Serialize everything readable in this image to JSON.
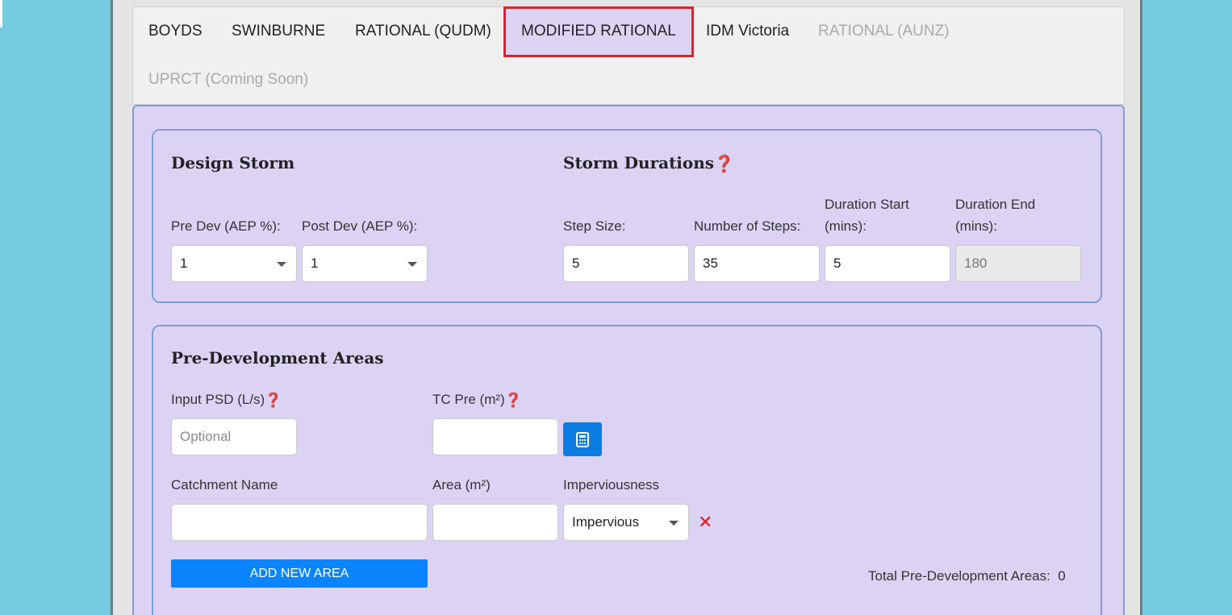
{
  "tabs": [
    {
      "label": "BOYDS",
      "state": "normal"
    },
    {
      "label": "SWINBURNE",
      "state": "normal"
    },
    {
      "label": "RATIONAL (QUDM)",
      "state": "normal"
    },
    {
      "label": "MODIFIED RATIONAL",
      "state": "active"
    },
    {
      "label": "IDM Victoria",
      "state": "normal"
    },
    {
      "label": "RATIONAL (AUNZ)",
      "state": "disabled"
    },
    {
      "label": "UPRCT (Coming Soon)",
      "state": "disabled"
    }
  ],
  "design_storm": {
    "title": "Design Storm",
    "pre_dev_label": "Pre Dev (AEP %):",
    "pre_dev_value": "1",
    "post_dev_label": "Post Dev (AEP %):",
    "post_dev_value": "1"
  },
  "storm_durations": {
    "title": "Storm Durations",
    "help_glyph": "❓",
    "step_size_label": "Step Size:",
    "step_size_value": "5",
    "num_steps_label": "Number of Steps:",
    "num_steps_value": "35",
    "duration_start_label_1": "Duration Start",
    "duration_start_label_2": "(mins):",
    "duration_start_value": "5",
    "duration_end_label_1": "Duration End",
    "duration_end_label_2": "(mins):",
    "duration_end_value": "180"
  },
  "pre_development": {
    "title": "Pre-Development Areas",
    "input_psd_label": "Input PSD (L/s)",
    "input_psd_placeholder": "Optional",
    "tc_pre_label": "TC Pre (m²)",
    "tc_pre_value": "",
    "calculator_icon": "calculator-icon",
    "catchment_name_label": "Catchment Name",
    "catchment_name_value": "",
    "area_label": "Area (m²)",
    "area_value": "",
    "imperviousness_label": "Imperviousness",
    "imperviousness_value": "Impervious",
    "remove_glyph": "✕",
    "add_button_label": "ADD NEW AREA",
    "total_label": "Total Pre-Development Areas:",
    "total_value": "0"
  },
  "colors": {
    "page_background": "#74cbe0",
    "panel_background": "#dcd3f4",
    "panel_border": "#7f9fd6",
    "active_tab_outline": "#d9232b",
    "primary_button": "#0a84ff",
    "remove_icon": "#e8141a"
  }
}
